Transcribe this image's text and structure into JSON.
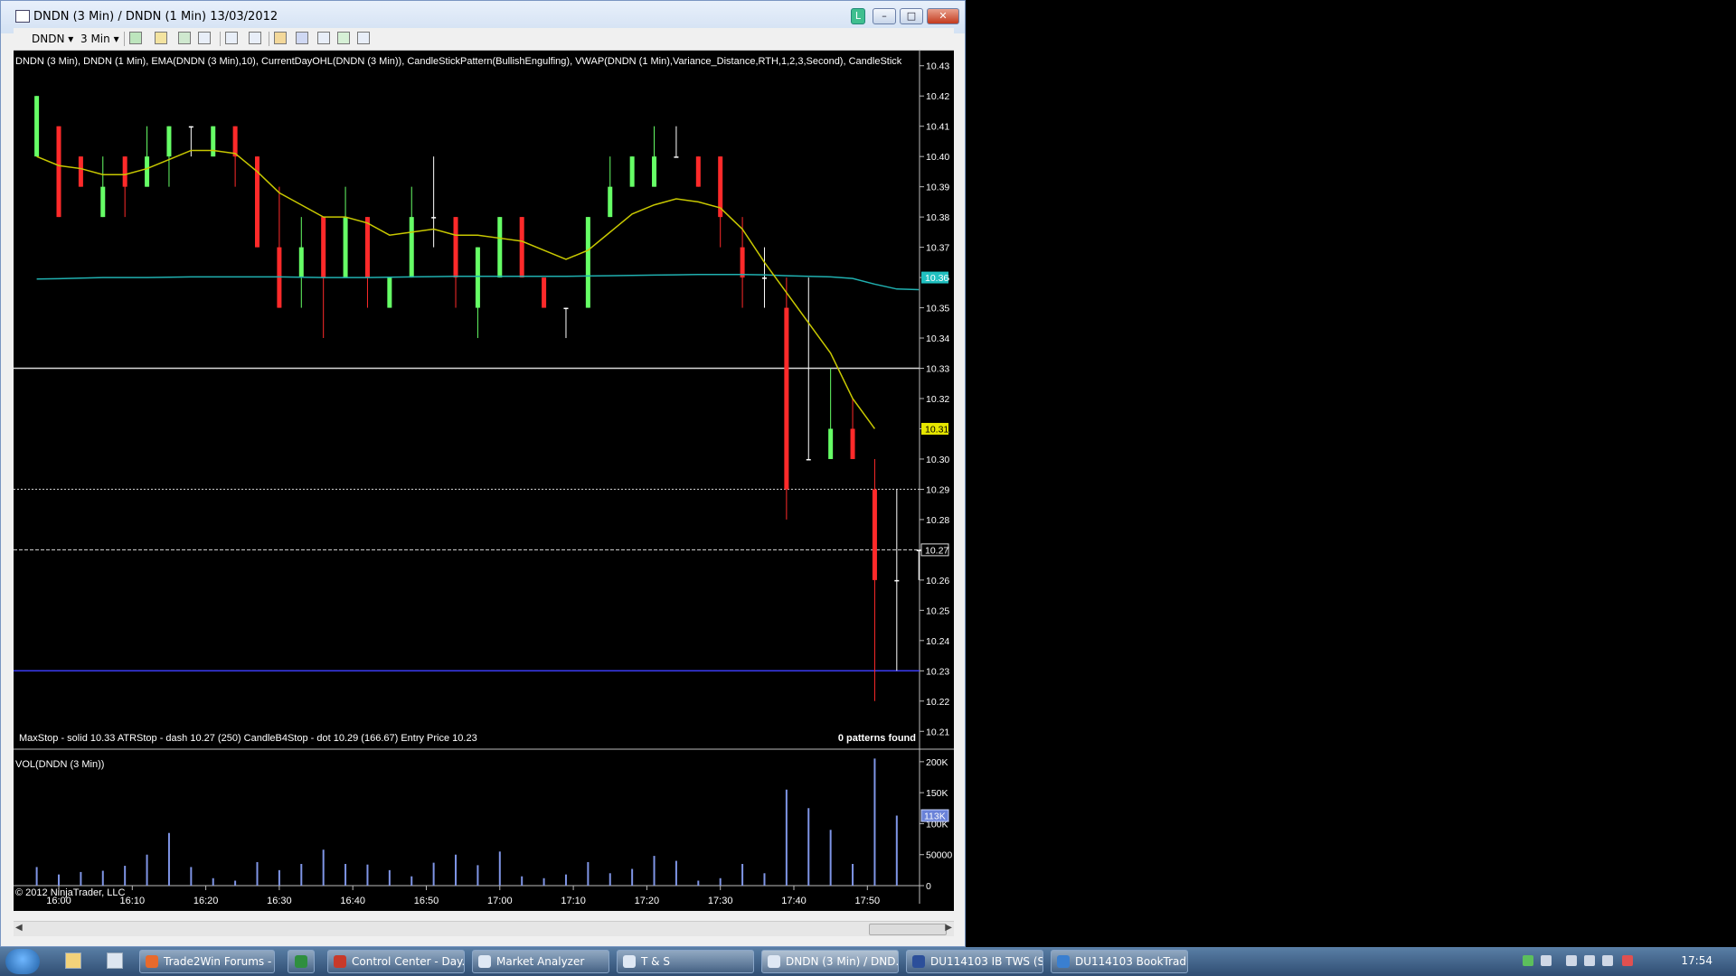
{
  "window": {
    "title": "DNDN (3 Min) / DNDN (1 Min)  13/03/2012",
    "l_badge": "L"
  },
  "toolbar": {
    "instrument": "DNDN",
    "interval": "3 Min"
  },
  "chart": {
    "indicator_line": "DNDN (3 Min), DNDN (1 Min), EMA(DNDN (3 Min),10), CurrentDayOHL(DNDN (3 Min)), CandleStickPattern(BullishEngulfing), VWAP(DNDN (1 Min),Variance_Distance,RTH,1,2,3,Second), CandleStick",
    "stops_text": "MaxStop - solid  10.33 ATRStop - dash  10.27 (250)  CandleB4Stop - dot  10.29 (166.67) Entry Price 10.23",
    "patterns_text": "0 patterns found",
    "volume_label": "VOL(DNDN (3 Min))",
    "copyright": "© 2012 NinjaTrader, LLC"
  },
  "chart_data": [
    {
      "type": "candlestick",
      "title": "DNDN (3 Min)",
      "ylim": [
        10.205,
        10.435
      ],
      "y_ticks": [
        "10.43",
        "10.42",
        "10.41",
        "10.40",
        "10.39",
        "10.38",
        "10.37",
        "10.36",
        "10.35",
        "10.34",
        "10.33",
        "10.32",
        "10.31",
        "10.30",
        "10.29",
        "10.28",
        "10.27",
        "10.26",
        "10.25",
        "10.24",
        "10.23",
        "10.22",
        "10.21"
      ],
      "x_ticks": [
        "16:00",
        "16:10",
        "16:20",
        "16:30",
        "16:40",
        "16:50",
        "17:00",
        "17:10",
        "17:20",
        "17:30",
        "17:40",
        "17:50"
      ],
      "price_badges": {
        "vwap": "10.36",
        "ema": "10.31",
        "last": "10.27"
      },
      "horizontal_lines": {
        "max_stop": 10.33,
        "candle_b4_stop": 10.29,
        "atr_stop": 10.27,
        "entry_price": 10.23
      },
      "candles": [
        {
          "t": "15:57",
          "o": 10.4,
          "h": 10.42,
          "l": 10.4,
          "c": 10.42
        },
        {
          "t": "16:00",
          "o": 10.41,
          "h": 10.41,
          "l": 10.38,
          "c": 10.38
        },
        {
          "t": "16:03",
          "o": 10.4,
          "h": 10.4,
          "l": 10.39,
          "c": 10.39
        },
        {
          "t": "16:06",
          "o": 10.38,
          "h": 10.4,
          "l": 10.38,
          "c": 10.39
        },
        {
          "t": "16:09",
          "o": 10.4,
          "h": 10.4,
          "l": 10.38,
          "c": 10.39
        },
        {
          "t": "16:12",
          "o": 10.39,
          "h": 10.41,
          "l": 10.39,
          "c": 10.4
        },
        {
          "t": "16:15",
          "o": 10.4,
          "h": 10.41,
          "l": 10.39,
          "c": 10.41
        },
        {
          "t": "16:18",
          "o": 10.41,
          "h": 10.41,
          "l": 10.4,
          "c": 10.41
        },
        {
          "t": "16:21",
          "o": 10.4,
          "h": 10.41,
          "l": 10.4,
          "c": 10.41
        },
        {
          "t": "16:24",
          "o": 10.41,
          "h": 10.41,
          "l": 10.39,
          "c": 10.4
        },
        {
          "t": "16:27",
          "o": 10.4,
          "h": 10.4,
          "l": 10.37,
          "c": 10.37
        },
        {
          "t": "16:30",
          "o": 10.37,
          "h": 10.39,
          "l": 10.35,
          "c": 10.35
        },
        {
          "t": "16:33",
          "o": 10.36,
          "h": 10.38,
          "l": 10.35,
          "c": 10.37
        },
        {
          "t": "16:36",
          "o": 10.38,
          "h": 10.38,
          "l": 10.34,
          "c": 10.36
        },
        {
          "t": "16:39",
          "o": 10.36,
          "h": 10.39,
          "l": 10.36,
          "c": 10.38
        },
        {
          "t": "16:42",
          "o": 10.38,
          "h": 10.38,
          "l": 10.35,
          "c": 10.36
        },
        {
          "t": "16:45",
          "o": 10.35,
          "h": 10.36,
          "l": 10.35,
          "c": 10.36
        },
        {
          "t": "16:48",
          "o": 10.36,
          "h": 10.39,
          "l": 10.36,
          "c": 10.38
        },
        {
          "t": "16:51",
          "o": 10.38,
          "h": 10.4,
          "l": 10.37,
          "c": 10.38
        },
        {
          "t": "16:54",
          "o": 10.38,
          "h": 10.38,
          "l": 10.35,
          "c": 10.36
        },
        {
          "t": "16:57",
          "o": 10.35,
          "h": 10.37,
          "l": 10.34,
          "c": 10.37
        },
        {
          "t": "17:00",
          "o": 10.36,
          "h": 10.38,
          "l": 10.36,
          "c": 10.38
        },
        {
          "t": "17:03",
          "o": 10.38,
          "h": 10.38,
          "l": 10.36,
          "c": 10.36
        },
        {
          "t": "17:06",
          "o": 10.36,
          "h": 10.36,
          "l": 10.35,
          "c": 10.35
        },
        {
          "t": "17:09",
          "o": 10.35,
          "h": 10.35,
          "l": 10.34,
          "c": 10.35
        },
        {
          "t": "17:12",
          "o": 10.35,
          "h": 10.38,
          "l": 10.35,
          "c": 10.38
        },
        {
          "t": "17:15",
          "o": 10.38,
          "h": 10.4,
          "l": 10.38,
          "c": 10.39
        },
        {
          "t": "17:18",
          "o": 10.39,
          "h": 10.4,
          "l": 10.39,
          "c": 10.4
        },
        {
          "t": "17:21",
          "o": 10.39,
          "h": 10.41,
          "l": 10.39,
          "c": 10.4
        },
        {
          "t": "17:24",
          "o": 10.4,
          "h": 10.41,
          "l": 10.4,
          "c": 10.4
        },
        {
          "t": "17:27",
          "o": 10.4,
          "h": 10.4,
          "l": 10.39,
          "c": 10.39
        },
        {
          "t": "17:30",
          "o": 10.4,
          "h": 10.4,
          "l": 10.37,
          "c": 10.38
        },
        {
          "t": "17:33",
          "o": 10.37,
          "h": 10.38,
          "l": 10.35,
          "c": 10.36
        },
        {
          "t": "17:36",
          "o": 10.36,
          "h": 10.37,
          "l": 10.35,
          "c": 10.36
        },
        {
          "t": "17:39",
          "o": 10.35,
          "h": 10.36,
          "l": 10.28,
          "c": 10.29
        },
        {
          "t": "17:42",
          "o": 10.3,
          "h": 10.36,
          "l": 10.3,
          "c": 10.3
        },
        {
          "t": "17:45",
          "o": 10.3,
          "h": 10.33,
          "l": 10.3,
          "c": 10.31
        },
        {
          "t": "17:48",
          "o": 10.31,
          "h": 10.32,
          "l": 10.3,
          "c": 10.3
        },
        {
          "t": "17:51",
          "o": 10.29,
          "h": 10.3,
          "l": 10.22,
          "c": 10.26
        },
        {
          "t": "17:54",
          "o": 10.26,
          "h": 10.29,
          "l": 10.23,
          "c": 10.26
        },
        {
          "t": "17:57",
          "o": 10.27,
          "h": 10.27,
          "l": 10.26,
          "c": 10.27
        }
      ],
      "ema_series": {
        "name": "EMA(DNDN (3 Min),10)",
        "color": "#c8c800",
        "values": [
          10.4,
          10.397,
          10.396,
          10.394,
          10.394,
          10.396,
          10.399,
          10.402,
          10.402,
          10.401,
          10.395,
          10.388,
          10.384,
          10.38,
          10.38,
          10.378,
          10.374,
          10.375,
          10.376,
          10.374,
          10.374,
          10.373,
          10.372,
          10.369,
          10.366,
          10.369,
          10.375,
          10.381,
          10.384,
          10.386,
          10.385,
          10.383,
          10.376,
          10.365,
          10.355,
          10.345,
          10.335,
          10.32,
          10.31
        ]
      },
      "vwap_series": {
        "name": "VWAP",
        "color": "#20c0c0",
        "values": [
          10.3595,
          10.3596,
          10.3598,
          10.36,
          10.36,
          10.36,
          10.3601,
          10.3602,
          10.3602,
          10.3602,
          10.3602,
          10.3602,
          10.3601,
          10.36,
          10.36,
          10.36,
          10.3601,
          10.3602,
          10.3603,
          10.3604,
          10.3604,
          10.3604,
          10.3604,
          10.3604,
          10.3604,
          10.3605,
          10.3606,
          10.3607,
          10.3608,
          10.3609,
          10.361,
          10.361,
          10.361,
          10.3609,
          10.3606,
          10.3604,
          10.3602,
          10.3597,
          10.3578,
          10.3562,
          10.356
        ]
      }
    },
    {
      "type": "bar",
      "title": "VOL(DNDN (3 Min))",
      "ylim": [
        0,
        210000
      ],
      "y_ticks": [
        "200K",
        "150K",
        "100K",
        "50000",
        "0"
      ],
      "badge": "113K",
      "values": [
        30000,
        18000,
        22000,
        24000,
        32000,
        50000,
        85000,
        30000,
        12000,
        8000,
        38000,
        25000,
        35000,
        58000,
        35000,
        34000,
        25000,
        15000,
        37000,
        50000,
        33000,
        55000,
        15000,
        12000,
        18000,
        38000,
        20000,
        27000,
        48000,
        40000,
        8000,
        12000,
        35000,
        20000,
        155000,
        125000,
        90000,
        35000,
        205000,
        113000,
        0
      ]
    }
  ],
  "taskbar": {
    "items": [
      {
        "label": "Trade2Win Forums - ..."
      },
      {
        "label": ""
      },
      {
        "label": "Control Center - Day..."
      },
      {
        "label": "Market Analyzer"
      },
      {
        "label": "T & S"
      },
      {
        "label": "DNDN (3 Min) / DND..."
      },
      {
        "label": "DU114103 IB TWS (Si..."
      },
      {
        "label": "DU114103 BookTrad..."
      }
    ],
    "clock": "17:54"
  }
}
